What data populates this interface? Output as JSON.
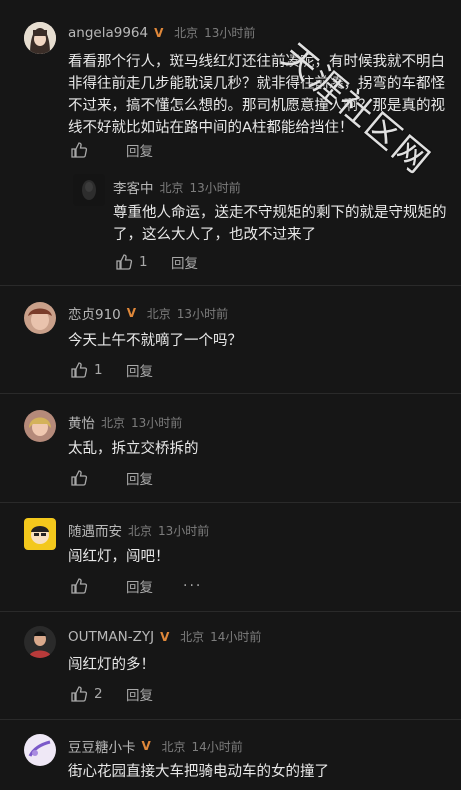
{
  "colors": {
    "background": "#161616",
    "badge": "#e0883a"
  },
  "watermark": "天涯社区网",
  "comments": [
    {
      "user": "angela9964",
      "location": "北京",
      "time": "13小时前",
      "text": "看看那个行人，斑马线红灯还往前凑呢，有时候我就不明白非得往前走几步能耽误几秒？就非得往前凑，拐弯的车都怪不过来，搞不懂怎么想的。那司机愿意撞人啊？那是真的视线不好就比如站在路中间的A柱都能给挡住！",
      "likes": "",
      "reply_label": "回复",
      "replies": [
        {
          "user": "李客中",
          "location": "北京",
          "time": "13小时前",
          "text": "尊重他人命运，送走不守规矩的剩下的就是守规矩的了，这么大人了，也改不过来了",
          "likes": "1",
          "reply_label": "回复"
        }
      ]
    },
    {
      "user": "恋贞910",
      "location": "北京",
      "time": "13小时前",
      "text": "今天上午不就嘀了一个吗？",
      "likes": "1",
      "reply_label": "回复"
    },
    {
      "user": "黄怡",
      "location": "北京",
      "time": "13小时前",
      "text": "太乱，拆立交桥拆的",
      "likes": "",
      "reply_label": "回复"
    },
    {
      "user": "随遇而安",
      "location": "北京",
      "time": "13小时前",
      "text": "闯红灯，闯吧！",
      "likes": "",
      "reply_label": "回复",
      "more": "···"
    },
    {
      "user": "OUTMAN-ZYJ",
      "location": "北京",
      "time": "14小时前",
      "text": "闯红灯的多！",
      "likes": "2",
      "reply_label": "回复"
    },
    {
      "user": "豆豆糖小卡",
      "location": "北京",
      "time": "14小时前",
      "text": "街心花园直接大车把骑电动车的女的撞了"
    }
  ]
}
